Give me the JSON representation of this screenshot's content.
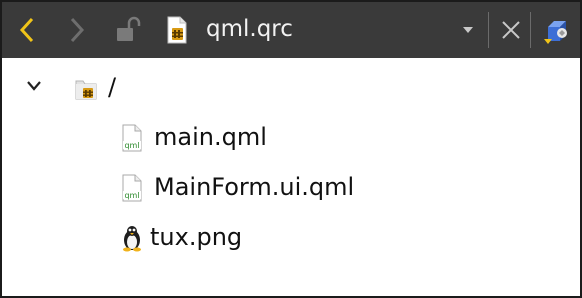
{
  "toolbar": {
    "back_icon": "chevron-left-icon",
    "forward_icon": "chevron-right-icon",
    "lock_icon": "unlocked-padlock-icon",
    "file_icon": "qrc-resource-file-icon",
    "title": "qml.qrc",
    "dropdown_icon": "dropdown-arrow-icon",
    "close_icon": "close-icon",
    "extra_icon": "split-view-icon",
    "accent_color": "#f0c419",
    "background_color": "#3a3a3a"
  },
  "tree": {
    "root": {
      "label": "/",
      "expanded": true,
      "icon": "resource-folder-icon"
    },
    "items": [
      {
        "label": "main.qml",
        "icon": "qml-file-icon"
      },
      {
        "label": "MainForm.ui.qml",
        "icon": "qml-file-icon"
      },
      {
        "label": "tux.png",
        "icon": "tux-penguin-icon"
      }
    ]
  }
}
